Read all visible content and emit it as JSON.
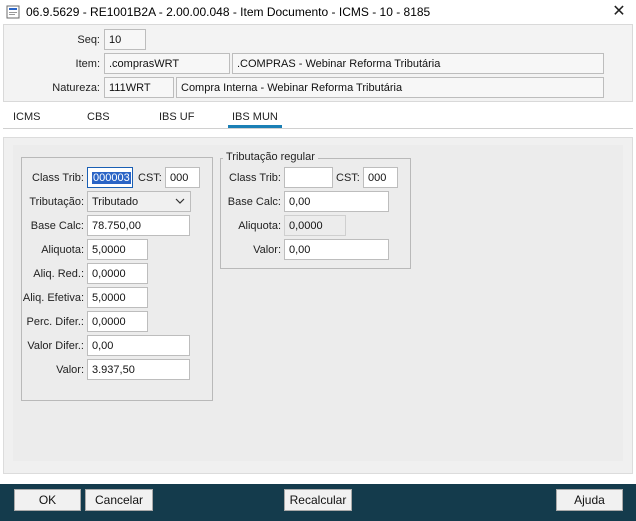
{
  "window": {
    "title": "06.9.5629 - RE1001B2A - 2.00.00.048 - Item Documento - ICMS - 10 - 8185",
    "close_glyph": "✕"
  },
  "header": {
    "seq_label": "Seq:",
    "seq_value": "10",
    "item_label": "Item:",
    "item_code": ".comprasWRT",
    "item_desc": ".COMPRAS - Webinar Reforma Tributária",
    "natureza_label": "Natureza:",
    "natureza_code": "111WRT",
    "natureza_desc": "Compra Interna - Webinar Reforma Tributária"
  },
  "tabs": [
    {
      "label": "ICMS",
      "active": false
    },
    {
      "label": "CBS",
      "active": false
    },
    {
      "label": "IBS UF",
      "active": false
    },
    {
      "label": "IBS MUN",
      "active": true
    }
  ],
  "left_group": {
    "class_trib_label": "Class Trib:",
    "class_trib_value": "000003",
    "cst_label": "CST:",
    "cst_value": "000",
    "tributacao_label": "Tributação:",
    "tributacao_value": "Tributado",
    "base_calc_label": "Base Calc:",
    "base_calc_value": "78.750,00",
    "aliquota_label": "Aliquota:",
    "aliquota_value": "5,0000",
    "aliq_red_label": "Aliq. Red.:",
    "aliq_red_value": "0,0000",
    "aliq_efetiva_label": "Aliq. Efetiva:",
    "aliq_efetiva_value": "5,0000",
    "perc_difer_label": "Perc. Difer.:",
    "perc_difer_value": "0,0000",
    "valor_difer_label": "Valor Difer.:",
    "valor_difer_value": "0,00",
    "valor_label": "Valor:",
    "valor_value": "3.937,50"
  },
  "right_group": {
    "title": "Tributação regular",
    "class_trib_label": "Class Trib:",
    "class_trib_value": "",
    "cst_label": "CST:",
    "cst_value": "000",
    "base_calc_label": "Base Calc:",
    "base_calc_value": "0,00",
    "aliquota_label": "Aliquota:",
    "aliquota_value": "0,0000",
    "valor_label": "Valor:",
    "valor_value": "0,00"
  },
  "footer": {
    "ok_label": "OK",
    "cancelar_label": "Cancelar",
    "recalcular_label": "Recalcular",
    "ajuda_label": "Ajuda"
  },
  "colors": {
    "footer_bg": "#143b4c",
    "tab_accent": "#1a7fb5",
    "selection": "#2a64c6"
  }
}
